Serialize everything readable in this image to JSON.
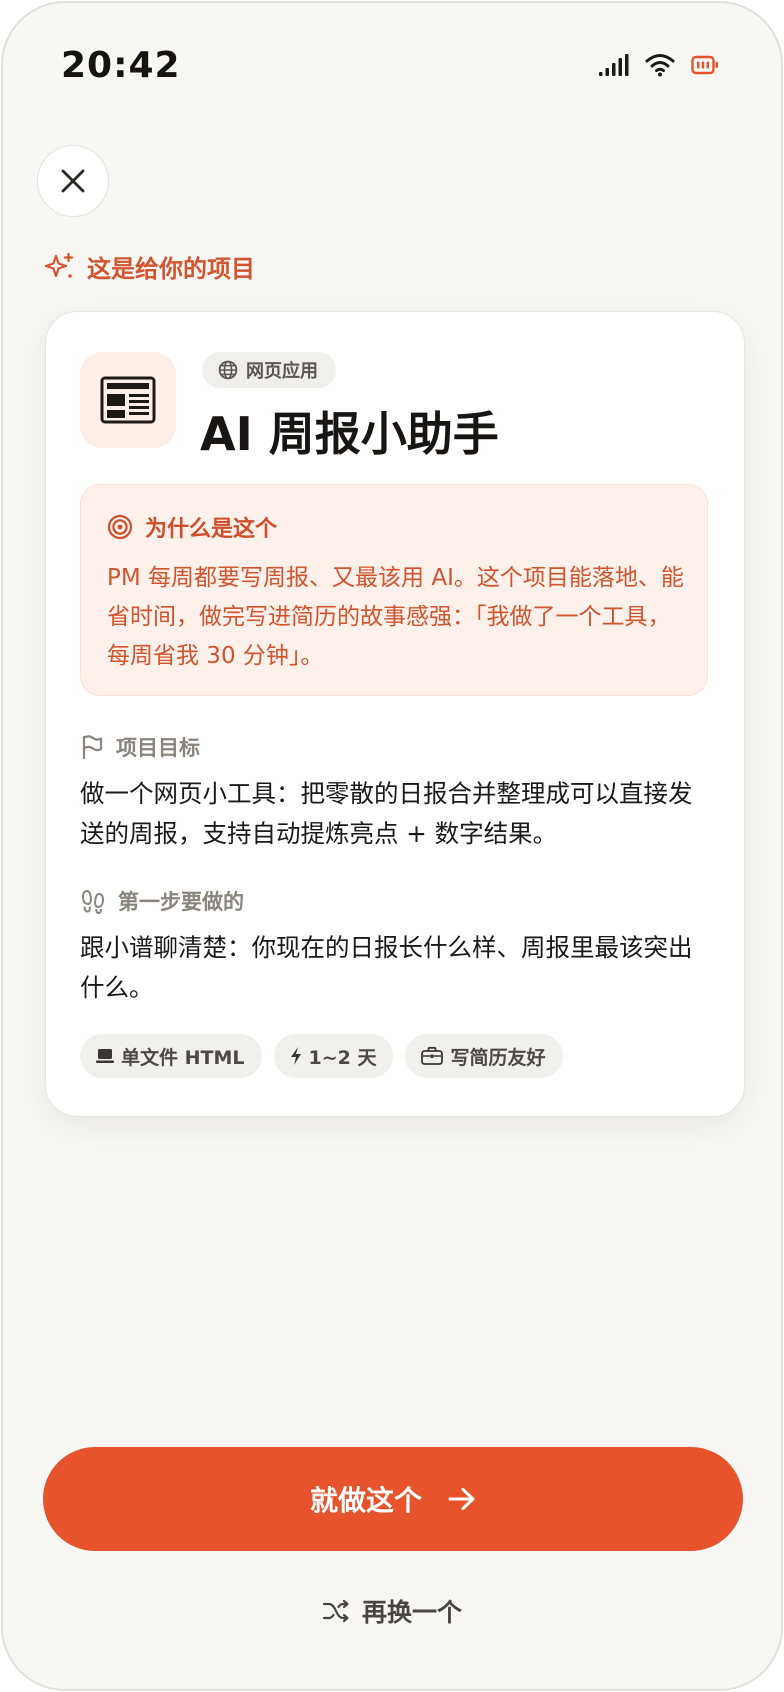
{
  "status_bar": {
    "time": "20:42"
  },
  "intro": {
    "label": "这是给你的项目"
  },
  "card": {
    "type_badge": "网页应用",
    "title": "AI 周报小助手",
    "reason": {
      "heading": "为什么是这个",
      "body": "PM 每周都要写周报、又最该用 AI。这个项目能落地、能省时间，做完写进简历的故事感强：「我做了一个工具，每周省我 30 分钟」。"
    },
    "goal": {
      "heading": "项目目标",
      "body": "做一个网页小工具：把零散的日报合并整理成可以直接发送的周报，支持自动提炼亮点 + 数字结果。"
    },
    "first_step": {
      "heading": "第一步要做的",
      "body": "跟小谱聊清楚：你现在的日报长什么样、周报里最该突出什么。"
    },
    "tags": [
      {
        "label": "单文件 HTML",
        "icon": "laptop-icon"
      },
      {
        "label": "1~2 天",
        "icon": "lightning-icon"
      },
      {
        "label": "写简历友好",
        "icon": "briefcase-icon"
      }
    ]
  },
  "actions": {
    "primary_label": "就做这个",
    "secondary_label": "再换一个"
  },
  "colors": {
    "accent": "#e6532c",
    "accent_text": "#d0542c",
    "background": "#f8f7f4",
    "card": "#ffffff"
  }
}
